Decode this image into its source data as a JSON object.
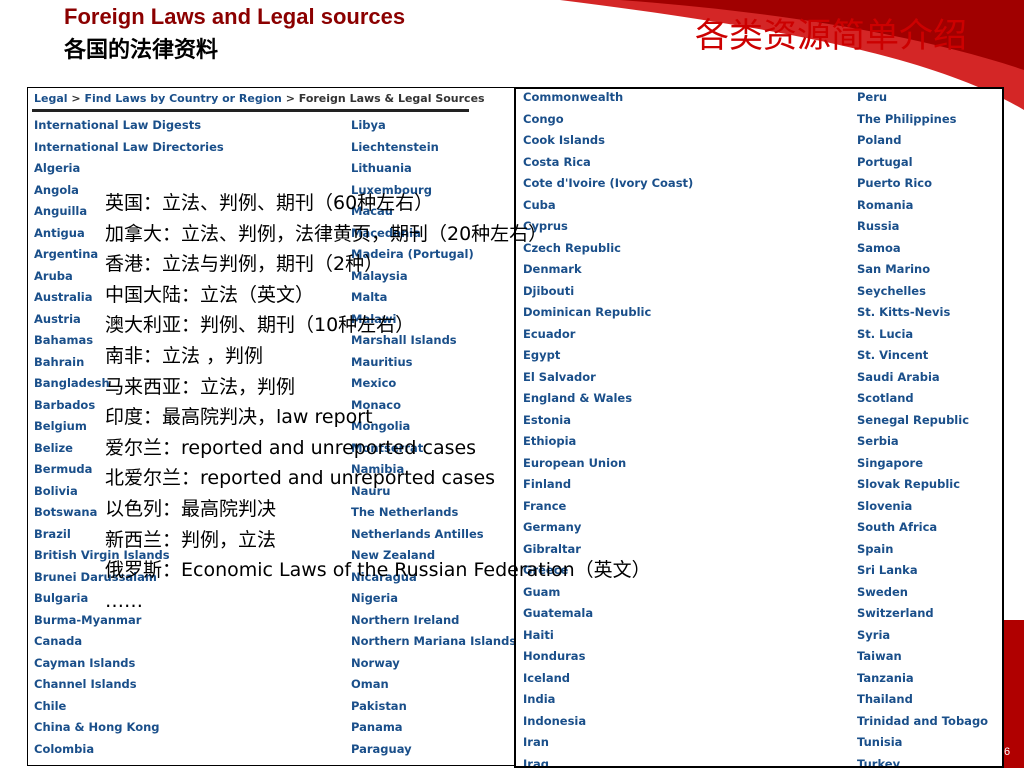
{
  "header": {
    "title_en": "Foreign Laws and Legal sources",
    "title_zh": "各国的法律资料",
    "slide_heading": "各类资源简单介绍"
  },
  "colors": {
    "accent_red": "#cc0000",
    "link_blue": "#1a4f8a",
    "title_dark_red": "#8b0000"
  },
  "breadcrumb": {
    "legal": "Legal",
    "sep": " > ",
    "find_laws": "Find Laws by Country or Region",
    "current": "Foreign Laws & Legal Sources"
  },
  "left_panel": {
    "col1": [
      "International Law Digests",
      "International Law Directories",
      "Algeria",
      "Angola",
      "Anguilla",
      "Antigua",
      "Argentina",
      "Aruba",
      "Australia",
      "Austria",
      "Bahamas",
      "Bahrain",
      "Bangladesh",
      "Barbados",
      "Belgium",
      "Belize",
      "Bermuda",
      "Bolivia",
      "Botswana",
      "Brazil",
      "British Virgin Islands",
      "Brunei Darussalam",
      "Bulgaria",
      "Burma-Myanmar",
      "Canada",
      "Cayman Islands",
      "Channel Islands",
      "Chile",
      "China & Hong Kong",
      "Colombia"
    ],
    "col2": [
      "Libya",
      "Liechtenstein",
      "Lithuania",
      "Luxembourg",
      "Macau",
      "Macedonia",
      "Madeira (Portugal)",
      "Malaysia",
      "Malta",
      "Malawi",
      "Marshall Islands",
      "Mauritius",
      "Mexico",
      "Monaco",
      "Mongolia",
      "Montserrat",
      "Namibia",
      "Nauru",
      "The Netherlands",
      "Netherlands Antilles",
      "New Zealand",
      "Nicaragua",
      "Nigeria",
      "Northern Ireland",
      "Northern Mariana Islands",
      "Norway",
      "Oman",
      "Pakistan",
      "Panama",
      "Paraguay"
    ]
  },
  "right_panel": {
    "col1": [
      "Commonwealth",
      "Congo",
      "Cook Islands",
      "Costa Rica",
      "Cote d'Ivoire (Ivory Coast)",
      "Cuba",
      "Cyprus",
      "Czech Republic",
      "Denmark",
      "Djibouti",
      "Dominican Republic",
      "Ecuador",
      "Egypt",
      "El Salvador",
      "England & Wales",
      "Estonia",
      "Ethiopia",
      "European Union",
      "Finland",
      "France",
      "Germany",
      "Gibraltar",
      "Greece",
      "Guam",
      "Guatemala",
      "Haiti",
      "Honduras",
      "Iceland",
      "India",
      "Indonesia",
      "Iran",
      "Iraq"
    ],
    "col2": [
      "Peru",
      "The Philippines",
      "Poland",
      "Portugal",
      "Puerto Rico",
      "Romania",
      "Russia",
      "Samoa",
      "San Marino",
      "Seychelles",
      "St. Kitts-Nevis",
      "St. Lucia",
      "St. Vincent",
      "Saudi Arabia",
      "Scotland",
      "Senegal Republic",
      "Serbia",
      "Singapore",
      "Slovak Republic",
      "Slovenia",
      "South Africa",
      "Spain",
      "Sri Lanka",
      "Sweden",
      "Switzerland",
      "Syria",
      "Taiwan",
      "Tanzania",
      "Thailand",
      "Trinidad and Tobago",
      "Tunisia",
      "Turkey"
    ]
  },
  "notes": [
    "英国：立法、判例、期刊（60种左右）",
    "加拿大：立法、判例，法律黄页，期刊（20种左右）",
    "香港：立法与判例，期刊（2种）",
    "中国大陆：立法（英文）",
    "澳大利亚：判例、期刊（10种左右）",
    "南非：立法 ，判例",
    "马来西亚：立法，判例",
    "印度：最高院判决，law report",
    "爱尔兰：reported and unreported cases",
    "北爱尔兰：reported and unreported cases",
    "以色列：最高院判决",
    "新西兰：判例，立法",
    "俄罗斯：Economic Laws of the Russian Federation（英文）",
    "……"
  ],
  "page_number": "6"
}
